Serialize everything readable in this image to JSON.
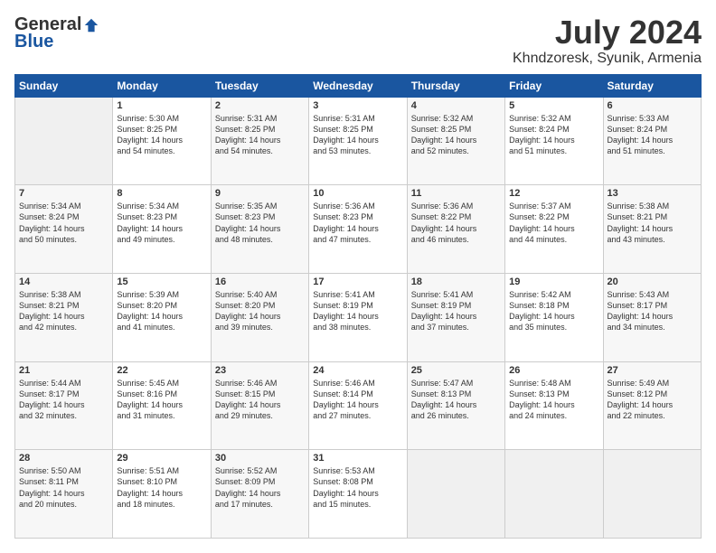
{
  "logo": {
    "general": "General",
    "blue": "Blue"
  },
  "header": {
    "month": "July 2024",
    "location": "Khndzoresk, Syunik, Armenia"
  },
  "weekdays": [
    "Sunday",
    "Monday",
    "Tuesday",
    "Wednesday",
    "Thursday",
    "Friday",
    "Saturday"
  ],
  "weeks": [
    [
      {
        "day": "",
        "info": ""
      },
      {
        "day": "1",
        "info": "Sunrise: 5:30 AM\nSunset: 8:25 PM\nDaylight: 14 hours\nand 54 minutes."
      },
      {
        "day": "2",
        "info": "Sunrise: 5:31 AM\nSunset: 8:25 PM\nDaylight: 14 hours\nand 54 minutes."
      },
      {
        "day": "3",
        "info": "Sunrise: 5:31 AM\nSunset: 8:25 PM\nDaylight: 14 hours\nand 53 minutes."
      },
      {
        "day": "4",
        "info": "Sunrise: 5:32 AM\nSunset: 8:25 PM\nDaylight: 14 hours\nand 52 minutes."
      },
      {
        "day": "5",
        "info": "Sunrise: 5:32 AM\nSunset: 8:24 PM\nDaylight: 14 hours\nand 51 minutes."
      },
      {
        "day": "6",
        "info": "Sunrise: 5:33 AM\nSunset: 8:24 PM\nDaylight: 14 hours\nand 51 minutes."
      }
    ],
    [
      {
        "day": "7",
        "info": "Sunrise: 5:34 AM\nSunset: 8:24 PM\nDaylight: 14 hours\nand 50 minutes."
      },
      {
        "day": "8",
        "info": "Sunrise: 5:34 AM\nSunset: 8:23 PM\nDaylight: 14 hours\nand 49 minutes."
      },
      {
        "day": "9",
        "info": "Sunrise: 5:35 AM\nSunset: 8:23 PM\nDaylight: 14 hours\nand 48 minutes."
      },
      {
        "day": "10",
        "info": "Sunrise: 5:36 AM\nSunset: 8:23 PM\nDaylight: 14 hours\nand 47 minutes."
      },
      {
        "day": "11",
        "info": "Sunrise: 5:36 AM\nSunset: 8:22 PM\nDaylight: 14 hours\nand 46 minutes."
      },
      {
        "day": "12",
        "info": "Sunrise: 5:37 AM\nSunset: 8:22 PM\nDaylight: 14 hours\nand 44 minutes."
      },
      {
        "day": "13",
        "info": "Sunrise: 5:38 AM\nSunset: 8:21 PM\nDaylight: 14 hours\nand 43 minutes."
      }
    ],
    [
      {
        "day": "14",
        "info": "Sunrise: 5:38 AM\nSunset: 8:21 PM\nDaylight: 14 hours\nand 42 minutes."
      },
      {
        "day": "15",
        "info": "Sunrise: 5:39 AM\nSunset: 8:20 PM\nDaylight: 14 hours\nand 41 minutes."
      },
      {
        "day": "16",
        "info": "Sunrise: 5:40 AM\nSunset: 8:20 PM\nDaylight: 14 hours\nand 39 minutes."
      },
      {
        "day": "17",
        "info": "Sunrise: 5:41 AM\nSunset: 8:19 PM\nDaylight: 14 hours\nand 38 minutes."
      },
      {
        "day": "18",
        "info": "Sunrise: 5:41 AM\nSunset: 8:19 PM\nDaylight: 14 hours\nand 37 minutes."
      },
      {
        "day": "19",
        "info": "Sunrise: 5:42 AM\nSunset: 8:18 PM\nDaylight: 14 hours\nand 35 minutes."
      },
      {
        "day": "20",
        "info": "Sunrise: 5:43 AM\nSunset: 8:17 PM\nDaylight: 14 hours\nand 34 minutes."
      }
    ],
    [
      {
        "day": "21",
        "info": "Sunrise: 5:44 AM\nSunset: 8:17 PM\nDaylight: 14 hours\nand 32 minutes."
      },
      {
        "day": "22",
        "info": "Sunrise: 5:45 AM\nSunset: 8:16 PM\nDaylight: 14 hours\nand 31 minutes."
      },
      {
        "day": "23",
        "info": "Sunrise: 5:46 AM\nSunset: 8:15 PM\nDaylight: 14 hours\nand 29 minutes."
      },
      {
        "day": "24",
        "info": "Sunrise: 5:46 AM\nSunset: 8:14 PM\nDaylight: 14 hours\nand 27 minutes."
      },
      {
        "day": "25",
        "info": "Sunrise: 5:47 AM\nSunset: 8:13 PM\nDaylight: 14 hours\nand 26 minutes."
      },
      {
        "day": "26",
        "info": "Sunrise: 5:48 AM\nSunset: 8:13 PM\nDaylight: 14 hours\nand 24 minutes."
      },
      {
        "day": "27",
        "info": "Sunrise: 5:49 AM\nSunset: 8:12 PM\nDaylight: 14 hours\nand 22 minutes."
      }
    ],
    [
      {
        "day": "28",
        "info": "Sunrise: 5:50 AM\nSunset: 8:11 PM\nDaylight: 14 hours\nand 20 minutes."
      },
      {
        "day": "29",
        "info": "Sunrise: 5:51 AM\nSunset: 8:10 PM\nDaylight: 14 hours\nand 18 minutes."
      },
      {
        "day": "30",
        "info": "Sunrise: 5:52 AM\nSunset: 8:09 PM\nDaylight: 14 hours\nand 17 minutes."
      },
      {
        "day": "31",
        "info": "Sunrise: 5:53 AM\nSunset: 8:08 PM\nDaylight: 14 hours\nand 15 minutes."
      },
      {
        "day": "",
        "info": ""
      },
      {
        "day": "",
        "info": ""
      },
      {
        "day": "",
        "info": ""
      }
    ]
  ]
}
